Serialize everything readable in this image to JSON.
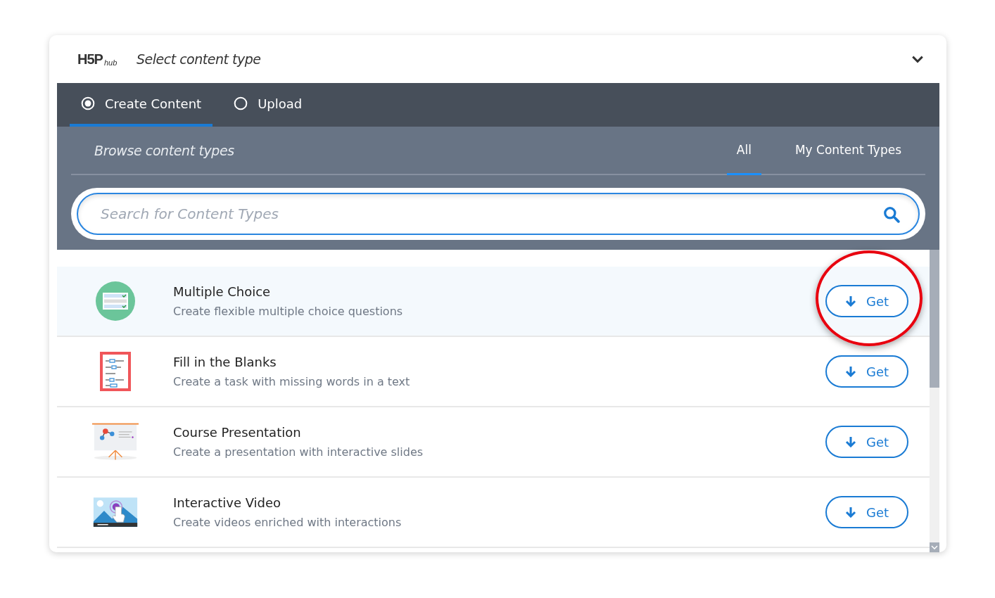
{
  "header": {
    "logo": "H5P",
    "logo_suffix": "hub",
    "title": "Select content type",
    "expanded": true
  },
  "tabs": [
    {
      "label": "Create Content",
      "selected": true
    },
    {
      "label": "Upload",
      "selected": false
    }
  ],
  "browse": {
    "title": "Browse content types",
    "filters": [
      {
        "label": "All",
        "selected": true
      },
      {
        "label": "My Content Types",
        "selected": false
      }
    ]
  },
  "search": {
    "placeholder": "Search for Content Types"
  },
  "items": [
    {
      "kind": "choice",
      "title": "Multiple Choice",
      "description": "Create flexible multiple choice questions",
      "button": "Get",
      "selected": true,
      "highlighted": true
    },
    {
      "kind": "blanks",
      "title": "Fill in the Blanks",
      "description": "Create a task with missing words in a text",
      "button": "Get",
      "selected": false,
      "highlighted": false
    },
    {
      "kind": "presentation",
      "title": "Course Presentation",
      "description": "Create a presentation with interactive slides",
      "button": "Get",
      "selected": false,
      "highlighted": false
    },
    {
      "kind": "video",
      "title": "Interactive Video",
      "description": "Create videos enriched with interactions",
      "button": "Get",
      "selected": false,
      "highlighted": false
    }
  ]
}
